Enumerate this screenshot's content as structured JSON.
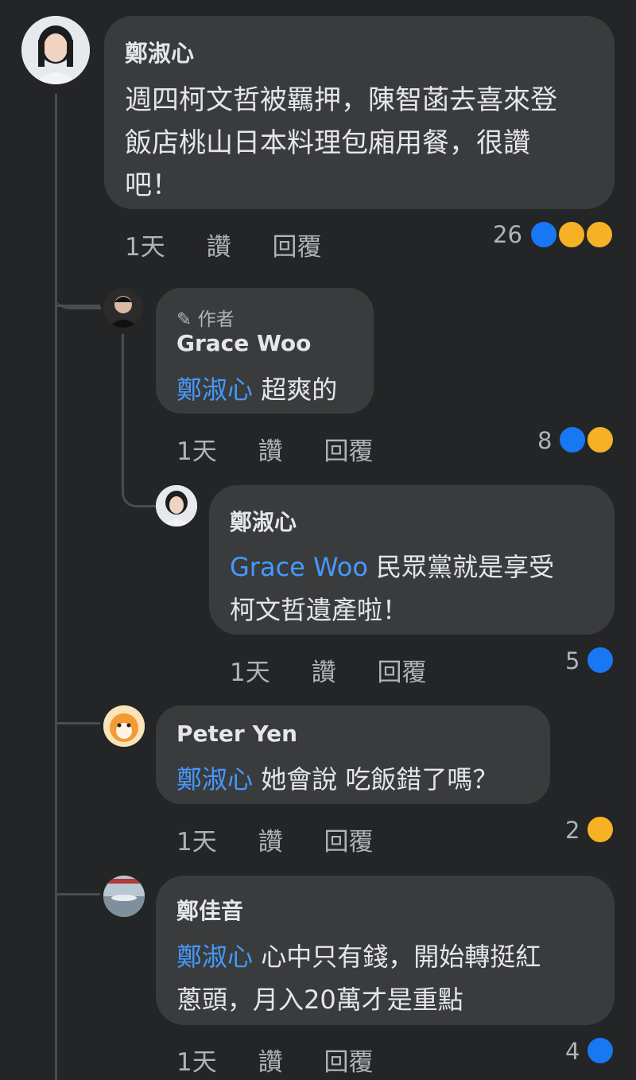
{
  "comments": [
    {
      "author": "鄭淑心",
      "lines": [
        "週四柯文哲被羈押，陳智菡去喜來登",
        "飯店桃山日本料理包廂用餐，很讚",
        "吧！"
      ],
      "time": "1天",
      "like_label": "讚",
      "reply_label": "回覆",
      "reaction_count": "26",
      "reactions": [
        "like-reaction",
        "haha-reaction",
        "wow-reaction"
      ]
    },
    {
      "badge": "作者",
      "author": "Grace Woo",
      "mention": "鄭淑心",
      "text": "超爽的",
      "time": "1天",
      "like_label": "讚",
      "reply_label": "回覆",
      "reaction_count": "8",
      "reactions": [
        "like-reaction",
        "haha-reaction"
      ]
    },
    {
      "author": "鄭淑心",
      "mention": "Grace Woo",
      "text": "民眾黨就是享受",
      "line2": "柯文哲遺產啦！",
      "time": "1天",
      "like_label": "讚",
      "reply_label": "回覆",
      "reaction_count": "5",
      "reactions": [
        "like-reaction"
      ]
    },
    {
      "author": "Peter Yen",
      "mention": "鄭淑心",
      "text": "她會說 吃飯錯了嗎？",
      "time": "1天",
      "like_label": "讚",
      "reply_label": "回覆",
      "reaction_count": "2",
      "reactions": [
        "haha-reaction"
      ]
    },
    {
      "author": "鄭佳音",
      "mention": "鄭淑心",
      "text": "心中只有錢，開始轉挺紅",
      "line2": "蔥頭，月入20萬才是重點",
      "time": "1天",
      "like_label": "讚",
      "reply_label": "回覆",
      "reaction_count": "4",
      "reactions": [
        "like-reaction"
      ]
    }
  ],
  "colors": {
    "background": "#242526",
    "bubble": "#3a3b3c",
    "mention": "#4599ff",
    "like": "#1877f2",
    "haha": "#f7b125"
  }
}
